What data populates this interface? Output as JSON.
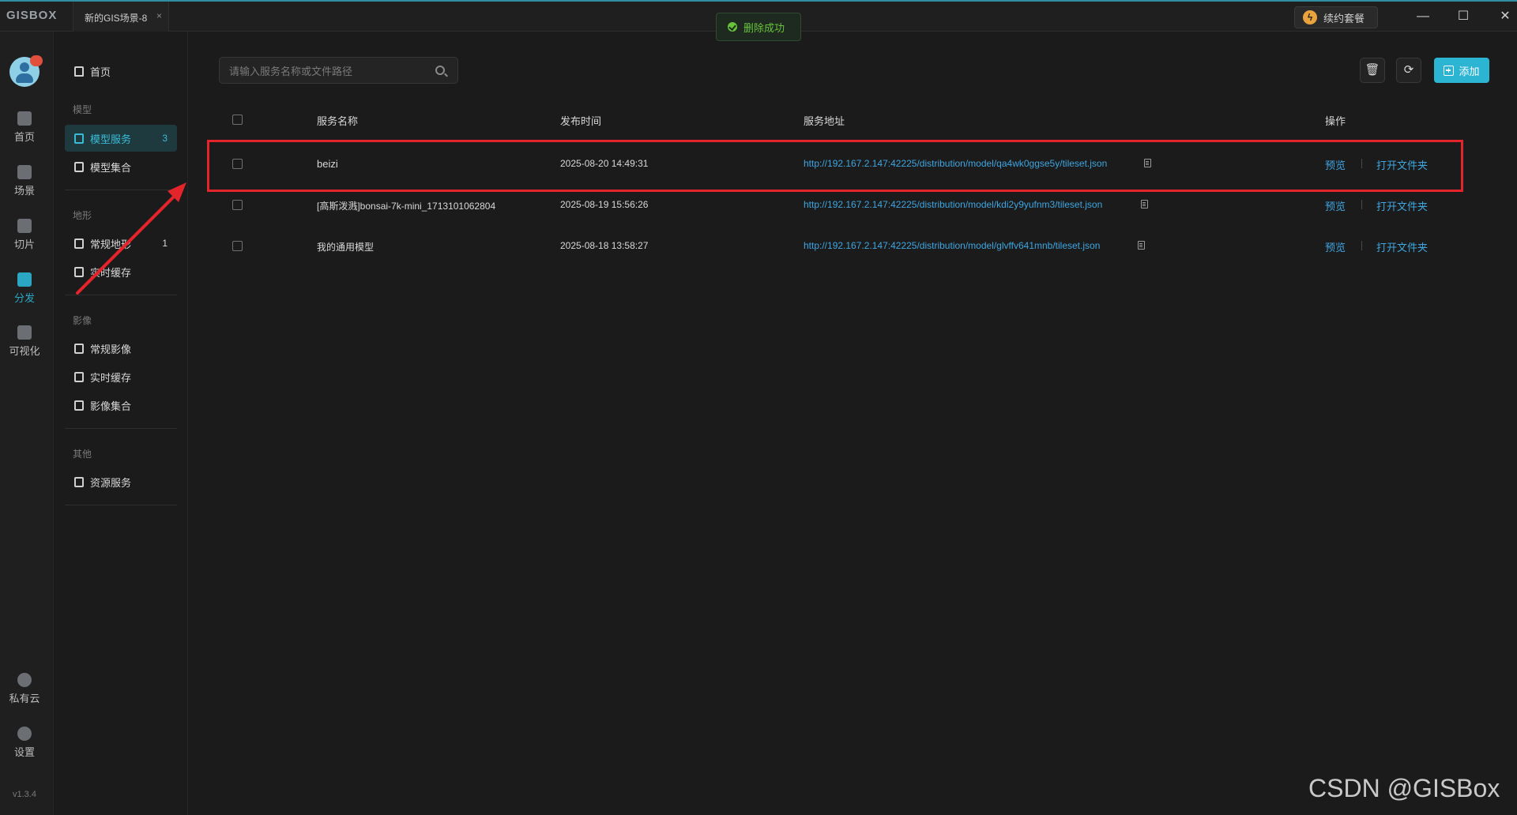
{
  "app": {
    "logo": "GISBOX",
    "tab_title": "新的GIS场景-8",
    "tab_close": "×",
    "toast": "删除成功",
    "renew_label": "续约套餐",
    "version": "v1.3.4"
  },
  "window": {
    "minimize": "—",
    "maximize": "☐",
    "close": "✕"
  },
  "rail": [
    {
      "label": "首页",
      "icon": "home-icon"
    },
    {
      "label": "场景",
      "icon": "cube-icon"
    },
    {
      "label": "切片",
      "icon": "slice-icon"
    },
    {
      "label": "分发",
      "icon": "distribute-icon",
      "active": true
    },
    {
      "label": "可视化",
      "icon": "visual-icon"
    },
    {
      "label": "私有云",
      "icon": "lock-cloud-icon"
    },
    {
      "label": "设置",
      "icon": "gear-icon"
    }
  ],
  "subnav": {
    "home": "首页",
    "groups": {
      "model": "模型",
      "terrain": "地形",
      "imagery": "影像",
      "other": "其他"
    },
    "items": {
      "model_service": "模型服务",
      "model_service_count": "3",
      "model_collection": "模型集合",
      "terrain_regular": "常规地形",
      "terrain_regular_count": "1",
      "terrain_cache": "实时缓存",
      "imagery_regular": "常规影像",
      "imagery_cache": "实时缓存",
      "imagery_collection": "影像集合",
      "resource_service": "资源服务"
    }
  },
  "toolbar": {
    "search_placeholder": "请输入服务名称或文件路径",
    "delete_icon": "trash-icon",
    "refresh_icon": "refresh-icon",
    "add_label": "添加"
  },
  "table": {
    "headers": {
      "name": "服务名称",
      "time": "发布时间",
      "url": "服务地址",
      "ops": "操作"
    },
    "rows": [
      {
        "name": "beizi",
        "time": "2025-08-20 14:49:31",
        "url": "http://192.167.2.147:42225/distribution/model/qa4wk0ggse5y/tileset.json",
        "preview": "预览",
        "open": "打开文件夹"
      },
      {
        "name": "[高斯泼溅]bonsai-7k-mini_1713101062804",
        "time": "2025-08-19 15:56:26",
        "url": "http://192.167.2.147:42225/distribution/model/kdi2y9yufnm3/tileset.json",
        "preview": "预览",
        "open": "打开文件夹"
      },
      {
        "name": "我的通用模型",
        "time": "2025-08-18 13:58:27",
        "url": "http://192.167.2.147:42225/distribution/model/glvffv641mnb/tileset.json",
        "preview": "预览",
        "open": "打开文件夹"
      }
    ]
  },
  "watermark": "CSDN @GISBox",
  "colors": {
    "accent": "#2bb5d3",
    "link": "#3ea6e0",
    "highlight": "#e3242b",
    "success": "#67c23a"
  }
}
